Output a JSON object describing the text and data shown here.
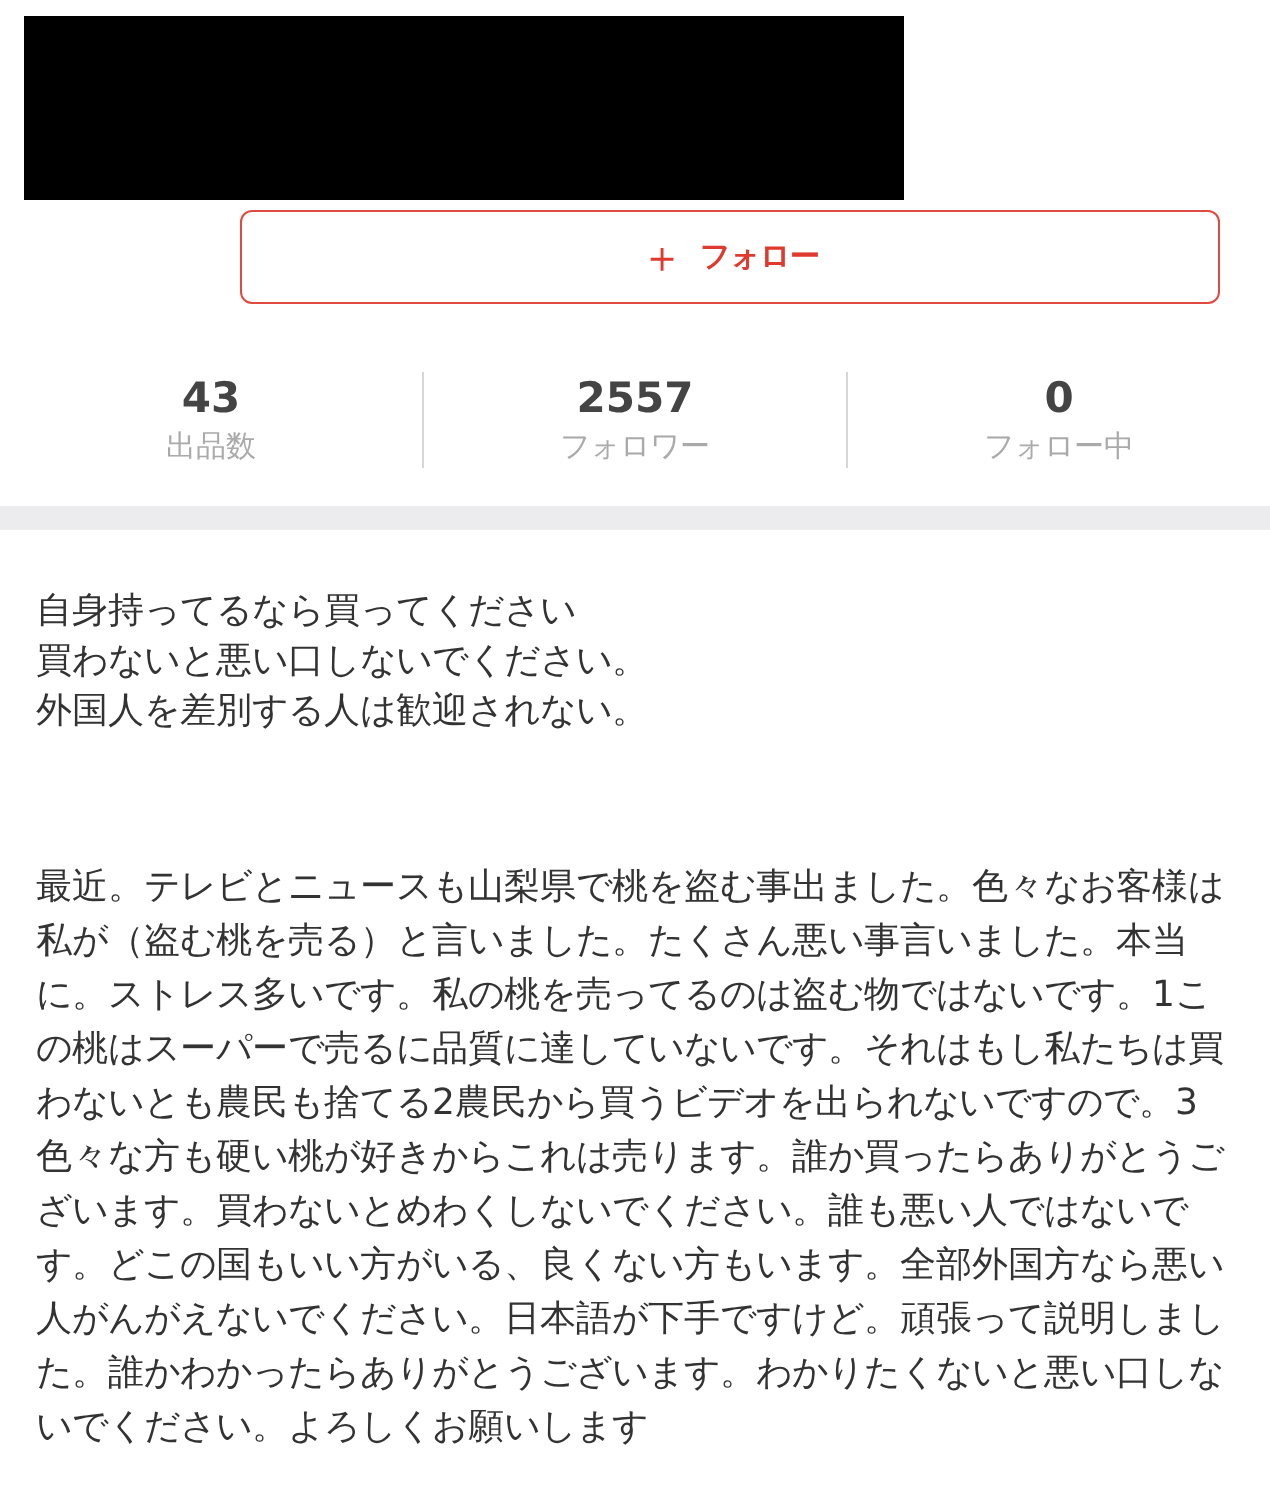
{
  "follow_button": {
    "icon": "＋",
    "label": "フォロー"
  },
  "stats": [
    {
      "value": "43",
      "label": "出品数"
    },
    {
      "value": "2557",
      "label": "フォロワー"
    },
    {
      "value": "0",
      "label": "フォロー中"
    }
  ],
  "intro_lines": [
    "自身持ってるなら買ってください",
    "買わないと悪い口しないでください。",
    "外国人を差別する人は歓迎されない。"
  ],
  "description": "最近。テレビとニュースも山梨県で桃を盗む事出ました。色々なお客様は私が（盗む桃を売る）と言いました。たくさん悪い事言いました。本当に。ストレス多いです。私の桃を売ってるのは盗む物ではないです。1この桃はスーパーで売るに品質に達していないです。それはもし私たちは買わないとも農民も捨てる2農民から買うビデオを出られないですので。3色々な方も硬い桃が好きからこれは売ります。誰か買ったらありがとうございます。買わないとめわくしないでください。誰も悪い人ではないです。どこの国もいい方がいる、良くない方もいます。全部外国方なら悪い人がんがえないでください。日本語が下手ですけど。頑張って説明しました。誰かわかったらありがとうございます。わかりたくないと悪い口しないでください。よろしくお願いします"
}
